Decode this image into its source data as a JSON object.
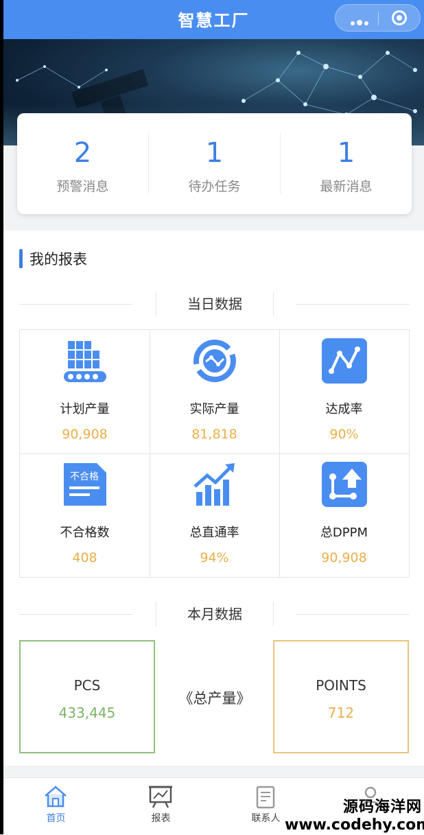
{
  "app": {
    "title": "智慧工厂"
  },
  "capsule": {
    "more_icon": "more-dots-icon",
    "close_icon": "target-icon"
  },
  "stats": [
    {
      "value": "2",
      "label": "预警消息"
    },
    {
      "value": "1",
      "label": "待办任务"
    },
    {
      "value": "1",
      "label": "最新消息"
    }
  ],
  "report": {
    "title": "我的报表",
    "daily_heading": "当日数据",
    "daily": [
      {
        "icon": "production-plan-icon",
        "label": "计划产量",
        "value": "90,908"
      },
      {
        "icon": "actual-output-icon",
        "label": "实际产量",
        "value": "81,818"
      },
      {
        "icon": "achievement-rate-icon",
        "label": "达成率",
        "value": "90%"
      },
      {
        "icon": "defect-doc-icon",
        "label": "不合格数",
        "value": "408",
        "icon_text": "不合格"
      },
      {
        "icon": "trend-up-icon",
        "label": "总直通率",
        "value": "94%"
      },
      {
        "icon": "dppm-icon",
        "label": "总DPPM",
        "value": "90,908"
      }
    ],
    "monthly_heading": "本月数据",
    "monthly": {
      "left": {
        "title": "PCS",
        "value": "433,445",
        "color": "#7bb366"
      },
      "center": "《总产量》",
      "right": {
        "title": "POINTS",
        "value": "712",
        "color": "#e8b04a"
      }
    }
  },
  "tabbar": [
    {
      "icon": "home-icon",
      "label": "首页",
      "active": true
    },
    {
      "icon": "report-icon",
      "label": "报表",
      "active": false
    },
    {
      "icon": "contacts-icon",
      "label": "联系人",
      "active": false
    },
    {
      "icon": "profile-icon",
      "label": "",
      "active": false
    }
  ],
  "watermark": {
    "line1": "源码海洋网",
    "line2": "www.codehy.com"
  },
  "colors": {
    "primary": "#3d7fe0",
    "nav": "#4a8df0",
    "value": "#e8b04a"
  }
}
